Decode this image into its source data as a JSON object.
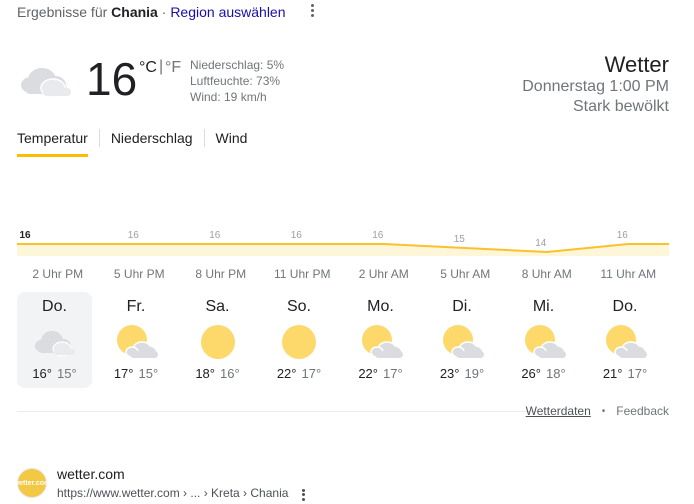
{
  "header": {
    "results_prefix": "Ergebnisse für",
    "location": "Chania",
    "separator": "·",
    "region_link": "Region auswählen"
  },
  "current": {
    "icon": "cloudy-icon",
    "temperature": "16",
    "unit_c": "°C",
    "unit_sep": "|",
    "unit_f": "°F",
    "precipitation": "Niederschlag: 5%",
    "humidity": "Luftfeuchte: 73%",
    "wind": "Wind: 19 km/h"
  },
  "summary": {
    "title": "Wetter",
    "time": "Donnerstag 1:00 PM",
    "condition": "Stark bewölkt"
  },
  "tabs": [
    {
      "label": "Temperatur",
      "active": true
    },
    {
      "label": "Niederschlag",
      "active": false
    },
    {
      "label": "Wind",
      "active": false
    }
  ],
  "chart_data": {
    "type": "area",
    "x": [
      "2 Uhr PM",
      "5 Uhr PM",
      "8 Uhr PM",
      "11 Uhr PM",
      "2 Uhr AM",
      "5 Uhr AM",
      "8 Uhr AM",
      "11 Uhr AM"
    ],
    "values": [
      16,
      16,
      16,
      16,
      16,
      15,
      14,
      16
    ],
    "labels": [
      "16",
      "16",
      "16",
      "16",
      "16",
      "15",
      "14",
      "16"
    ],
    "ylim": [
      10,
      20
    ],
    "colors": {
      "line": "#fbc02d",
      "fill": "#fef6d8"
    }
  },
  "days": [
    {
      "name": "Do.",
      "icon": "cloudy-icon",
      "high": "16°",
      "low": "15°",
      "selected": true
    },
    {
      "name": "Fr.",
      "icon": "partly-cloudy-icon",
      "high": "17°",
      "low": "15°",
      "selected": false
    },
    {
      "name": "Sa.",
      "icon": "sunny-icon",
      "high": "18°",
      "low": "16°",
      "selected": false
    },
    {
      "name": "So.",
      "icon": "sunny-icon",
      "high": "22°",
      "low": "17°",
      "selected": false
    },
    {
      "name": "Mo.",
      "icon": "partly-cloudy-icon",
      "high": "22°",
      "low": "17°",
      "selected": false
    },
    {
      "name": "Di.",
      "icon": "partly-cloudy-icon",
      "high": "23°",
      "low": "19°",
      "selected": false
    },
    {
      "name": "Mi.",
      "icon": "partly-cloudy-icon",
      "high": "26°",
      "low": "18°",
      "selected": false
    },
    {
      "name": "Do.",
      "icon": "partly-cloudy-icon",
      "high": "21°",
      "low": "17°",
      "selected": false
    }
  ],
  "footer": {
    "data_link": "Wetterdaten",
    "dot": "•",
    "feedback": "Feedback"
  },
  "source": {
    "logo_text": "wetter.com",
    "name": "wetter.com",
    "url": "https://www.wetter.com › ... › Kreta › Chania"
  },
  "colors": {
    "accent": "#fbbc04",
    "sun": "#fcd96a",
    "cloud": "#dadce0",
    "link": "#1a0dab"
  }
}
